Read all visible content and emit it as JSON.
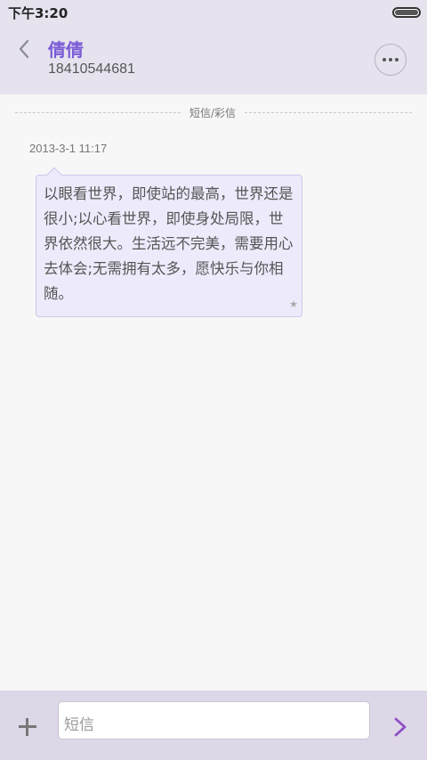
{
  "status_bar": {
    "time": "下午3:20"
  },
  "header": {
    "contact_name": "倩倩",
    "phone_number": "18410544681"
  },
  "thread": {
    "divider_label": "短信/彩信",
    "messages": [
      {
        "timestamp": "2013-3-1 11:17",
        "text": "以眼看世界，即使站的最高，世界还是很小;以心看世界，即使身处局限，世界依然很大。生活远不完美，需要用心去体会;无需拥有太多，愿快乐与你相随。"
      }
    ]
  },
  "composer": {
    "placeholder": "短信"
  },
  "colors": {
    "accent": "#7b5bd6",
    "header_bg": "#e6e3ef",
    "bubble_bg": "#edebfb",
    "bubble_border": "#cfc6ec",
    "bottom_bar_bg": "#ddd7e8",
    "send_arrow": "#8e4fc4"
  },
  "icons": {
    "back": "chevron-left-icon",
    "more": "more-dots-icon",
    "star": "star-icon",
    "add": "plus-icon",
    "send": "chevron-right-icon",
    "battery": "battery-icon"
  }
}
